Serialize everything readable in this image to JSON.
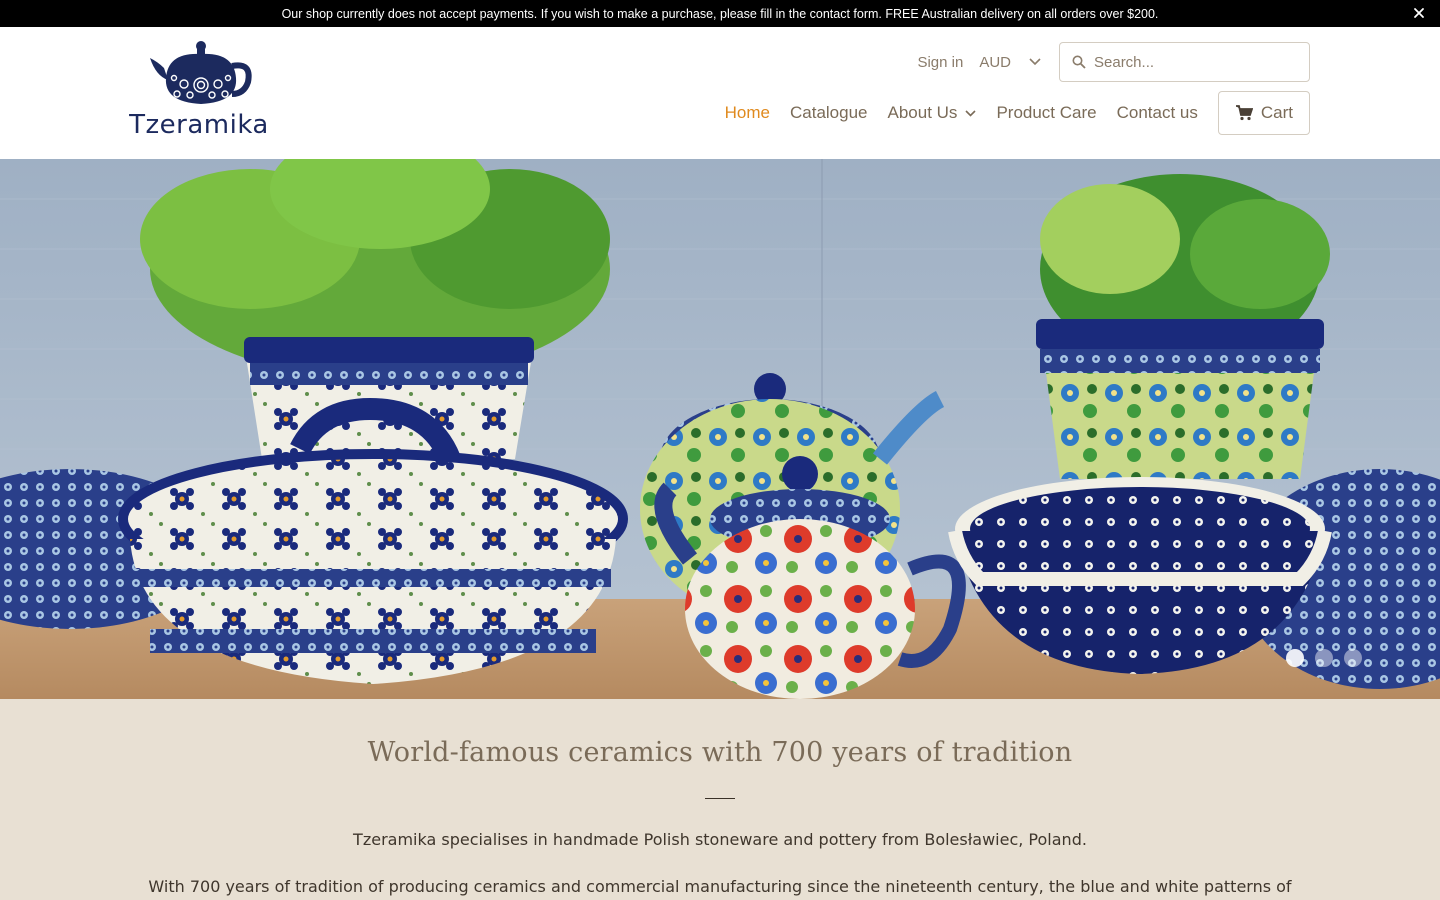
{
  "announcement": {
    "text": "Our shop currently does not accept payments. If you wish to make a purchase, please fill in the contact form. FREE Australian delivery on all orders over $200.",
    "close_icon": "close-icon"
  },
  "brand": {
    "name": "Tzeramika",
    "logo_icon": "teapot-logo"
  },
  "header": {
    "signin": "Sign in",
    "currency": "AUD",
    "search_placeholder": "Search...",
    "cart_label": "Cart"
  },
  "nav": {
    "items": [
      {
        "label": "Home",
        "active": true
      },
      {
        "label": "Catalogue",
        "active": false
      },
      {
        "label": "About Us",
        "active": false,
        "dropdown": true
      },
      {
        "label": "Product Care",
        "active": false
      },
      {
        "label": "Contact us",
        "active": false
      }
    ]
  },
  "hero": {
    "slide_count": 3,
    "active_slide": 1
  },
  "intro": {
    "heading": "World-famous ceramics with 700 years of tradition",
    "paragraph1": "Tzeramika specialises in handmade Polish stoneware and pottery from Bolesławiec, Poland.",
    "paragraph2": "With 700 years of tradition of producing ceramics and commercial manufacturing since the nineteenth century, the blue and white patterns of"
  },
  "colors": {
    "accent": "#e08a1e",
    "text": "#7a6b58",
    "brand_blue": "#1c2a5e",
    "intro_bg": "#e8e0d3"
  }
}
